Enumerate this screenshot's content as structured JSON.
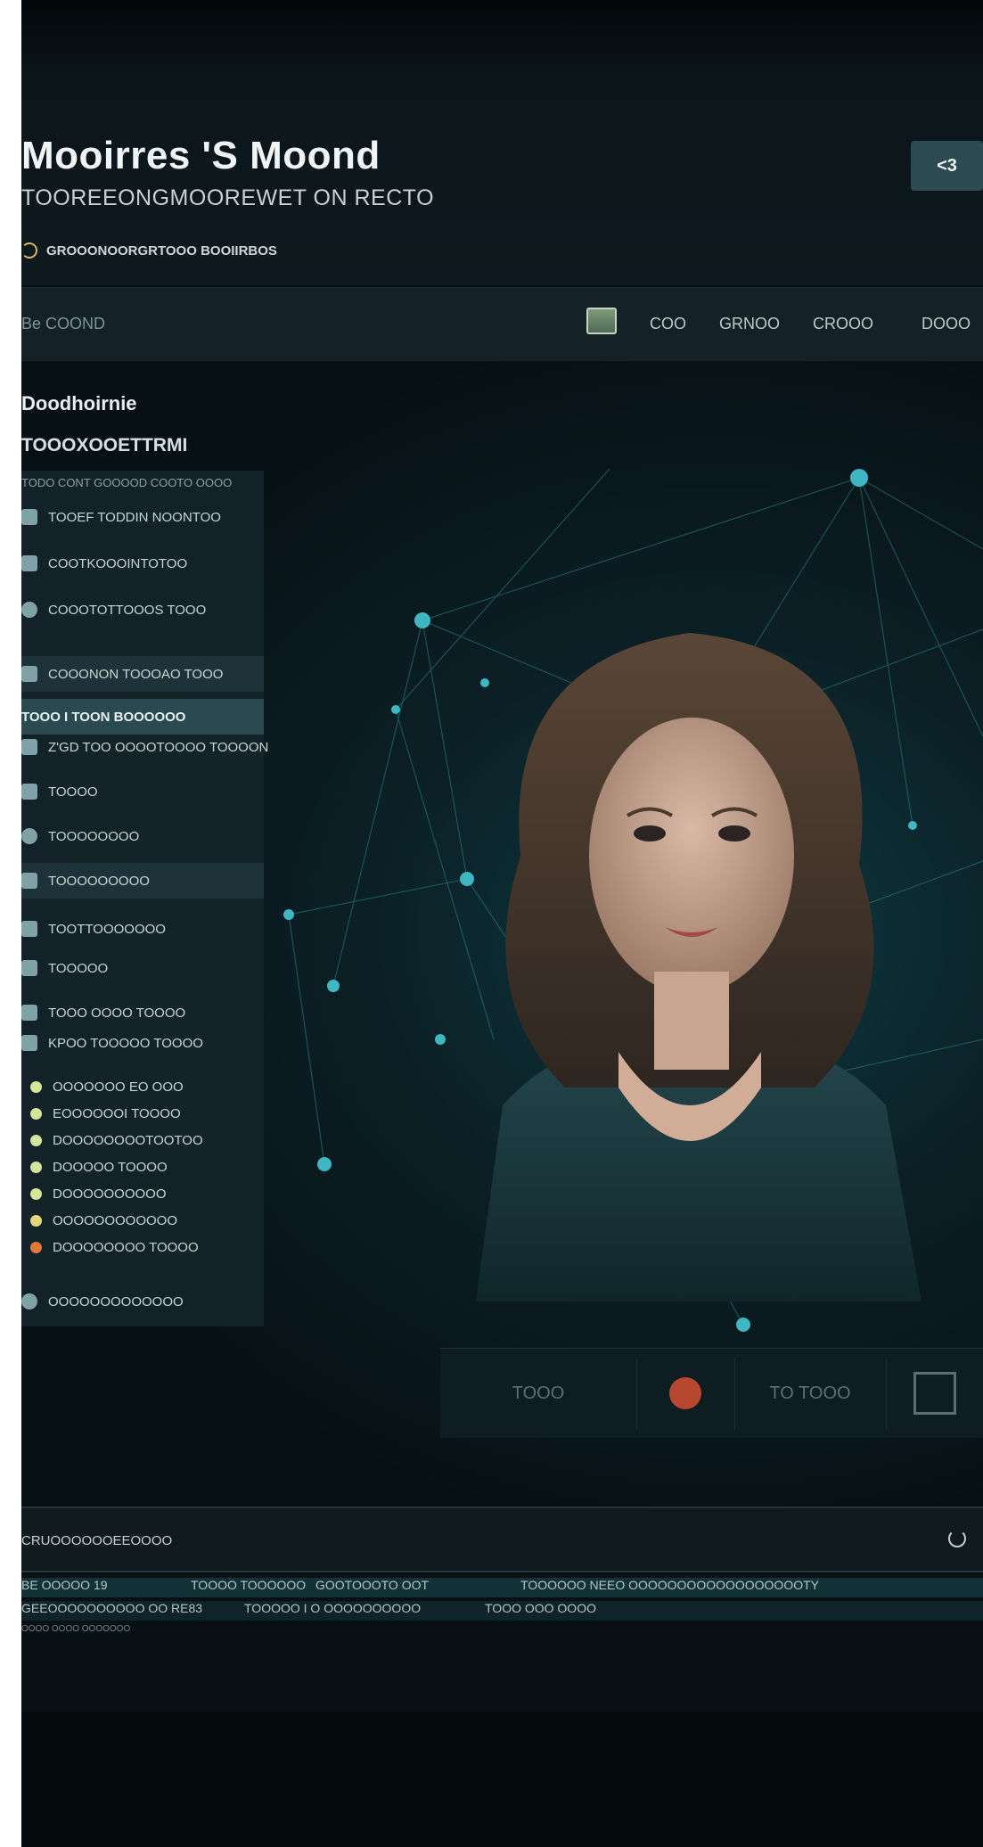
{
  "header": {
    "title": "Mooirres 'S Moond",
    "subtitle": "TOOREEONGMOOREWET ON RECTO",
    "tagline": "GROOONOORGRTOOO BOOIIRBOS",
    "button_label": "<3"
  },
  "nav": {
    "search_label": "Be COOND",
    "links": [
      "COO",
      "GRNOO",
      "CROOO",
      "DOOO"
    ]
  },
  "sidebar": {
    "heading": "Doodhoirnie",
    "subheading": "TOOOXOOETTRMI",
    "hint": "TODO CONT GOOOOD COOTO OOOO",
    "items": [
      {
        "label": "TOOEF TODDIN NOONTOO",
        "icon": "chart-icon"
      },
      {
        "label": "COOTKOOOINTOTOO",
        "icon": "list-icon"
      },
      {
        "label": "COOOTOTTOOOS TOOO",
        "icon": "leaf-icon"
      },
      {
        "label": "COOONON TOOOAO TOOO",
        "icon": "number-icon"
      },
      {
        "label": "TOOO I TOON BOOOOOO",
        "icon": "none"
      },
      {
        "label": "Z'GD TOO OOOOTOOOO TOOOON",
        "icon": "z-icon"
      },
      {
        "label": "TOOOO",
        "icon": "user-icon"
      },
      {
        "label": "TOOOOOOOO",
        "icon": "gear-icon"
      },
      {
        "label": "TOOOOOOOOO",
        "icon": "document-icon"
      },
      {
        "label": "TOOTTOOOOOOO",
        "icon": "folder-icon"
      },
      {
        "label": "TOOOOO",
        "icon": "help-icon"
      },
      {
        "label": "TOOO OOOO TOOOO",
        "icon": "grid-icon"
      },
      {
        "label": "KPOO TOOOOO TOOOO",
        "icon": "table-icon"
      }
    ],
    "status_items": [
      {
        "label": "OOOOOOO EO OOO",
        "color": "#d7e59a"
      },
      {
        "label": "EOOOOOOI TOOOO",
        "color": "#d7e59a"
      },
      {
        "label": "DOOOOOOOOTOOTOO",
        "color": "#d7e59a"
      },
      {
        "label": "DOOOOO TOOOO",
        "color": "#d7e59a"
      },
      {
        "label": "DOOOOOOOOOO",
        "color": "#d7e59a"
      },
      {
        "label": "OOOOOOOOOOOO",
        "color": "#e6d67a"
      },
      {
        "label": "DOOOOOOOO TOOOO",
        "color": "#e2793a"
      }
    ],
    "footer_item": "OOOOOOOOOOOOO"
  },
  "media_controls": {
    "play_label": "TOOO",
    "time_label": "TO TOOO"
  },
  "section": {
    "title": "CRUOOOOOOEEOOOO",
    "rows": [
      {
        "col1": "BE OOOOO 19",
        "col2": "TOOOO TOOOOOO",
        "col3": "GOOTOOOTO OOT",
        "col4": "TOOOOOO NEEO OOOOOOOOOOOOOOOOOOTY"
      },
      {
        "col1": "GEEOOOOOOOOOO OO RE83",
        "col2": "TOOOOO I O OOOOOOOOOO",
        "col3": "TOOO OOO OOOO",
        "col4": ""
      },
      {
        "col1": "OOOO OOOO OOOOOOO",
        "col2": "",
        "col3": "",
        "col4": ""
      }
    ]
  }
}
